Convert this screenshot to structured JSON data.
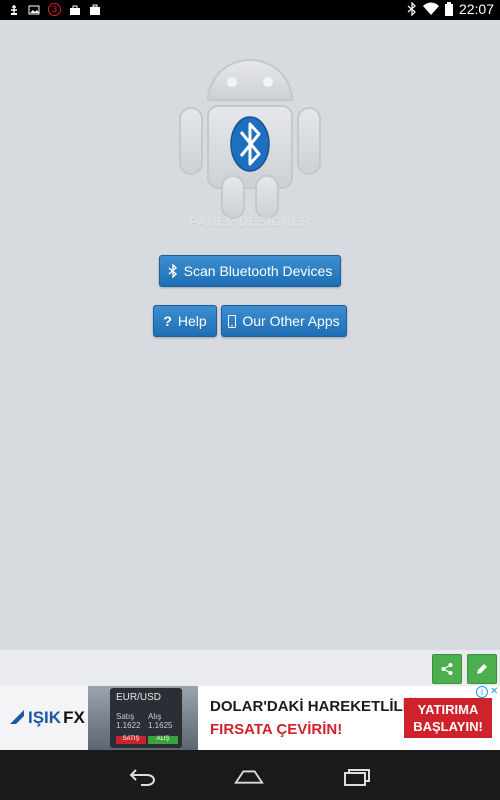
{
  "status_bar": {
    "time": "22:07",
    "notification_count": "3",
    "left_icons": [
      "usb-icon",
      "image-icon",
      "notification-count-icon",
      "bag-icon",
      "briefcase-icon"
    ],
    "right_icons": [
      "bluetooth-icon",
      "wifi-icon",
      "battery-icon"
    ]
  },
  "logo": {
    "caption": "PANEL DESIGNER",
    "icon": "android-bluetooth-logo"
  },
  "buttons": {
    "scan": {
      "label": "Scan Bluetooth Devices",
      "icon": "bluetooth-icon"
    },
    "help": {
      "label": "Help",
      "icon": "question-icon"
    },
    "other_apps": {
      "label": "Our Other Apps",
      "icon": "mobile-icon"
    }
  },
  "actions": {
    "share_icon": "share-icon",
    "edit_icon": "pencil-icon",
    "color": "#4cae4c"
  },
  "ad": {
    "brand_primary": "IŞIK",
    "brand_secondary": "FX",
    "pair": "EUR/USD",
    "sell_label": "Satış",
    "sell_value": "1.1622",
    "buy_label": "Alış",
    "buy_value": "1.1625",
    "sell_btn": "SATIŞ",
    "buy_btn": "ALIŞ",
    "headline": "DOLAR'DAKİ HAREKETLİLİĞİ",
    "subline": "FIRSATA ÇEVİRİN!",
    "cta": "YATIRIMA BAŞLAYIN!",
    "accent": "#d0222a"
  },
  "nav": {
    "icons": [
      "back-icon",
      "home-icon",
      "recent-apps-icon"
    ]
  },
  "colors": {
    "background": "#d7dade",
    "button_blue": "#2a7cc2",
    "logo_blue": "#1f6fc0"
  }
}
